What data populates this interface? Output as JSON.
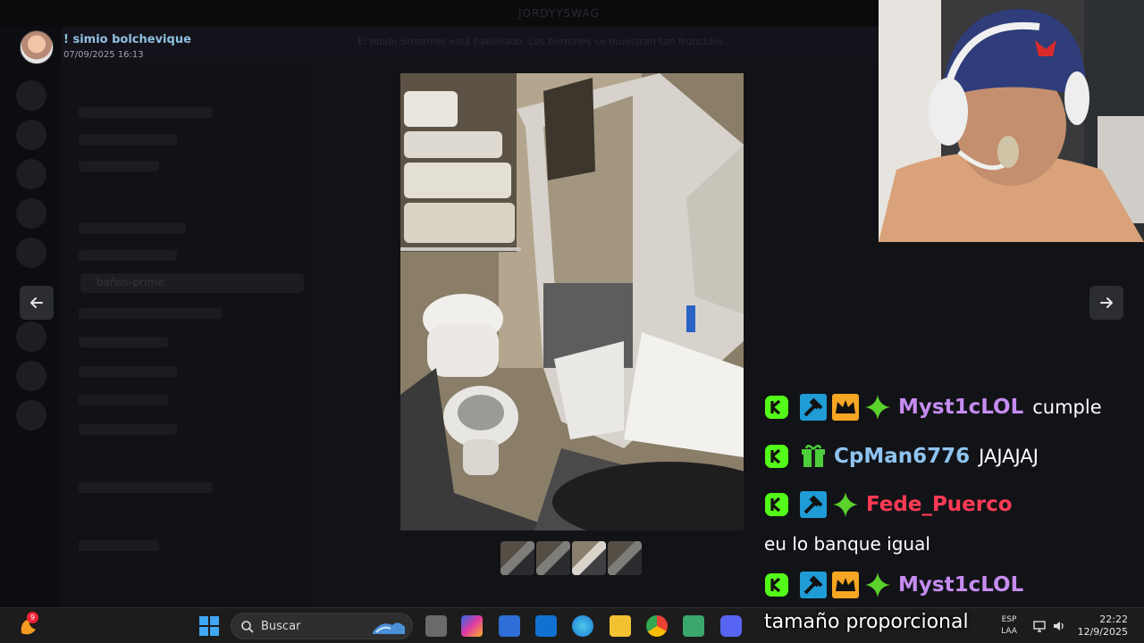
{
  "window": {
    "server_title": "JORDYY5WAG"
  },
  "background": {
    "banner_text": "El modo Streamer está habilitado. Los borrones se muestran tan fruncidos",
    "server_name": "JORDYY5WAG",
    "active_channel": "baños-prime",
    "chat_header": "baños-p"
  },
  "viewer": {
    "author": "! simio bolchevique",
    "date": "07/09/2025 16:13",
    "thumb_count": 4,
    "active_thumb": 3
  },
  "chat": [
    {
      "user": "Myst1cLOL",
      "user_color": "#c58cf0",
      "message": "cumple",
      "badges": [
        "kick",
        "moderator",
        "crown",
        "sparkle"
      ]
    },
    {
      "user": "CpMan6776",
      "user_color": "#8ec4f0",
      "message": "JAJAJAJ",
      "badges": [
        "kick",
        "gift"
      ]
    },
    {
      "user": "Fede_Puerco",
      "user_color": "#ff3a55",
      "message": "eu lo banque igual",
      "badges": [
        "kick",
        "moderator",
        "sparkle"
      ]
    },
    {
      "user": "Myst1cLOL",
      "user_color": "#c58cf0",
      "message": "",
      "badges": [
        "kick",
        "moderator",
        "crown",
        "sparkle"
      ]
    }
  ],
  "overlay_text": "tamaño proporcional",
  "taskbar": {
    "widget_badge": "9",
    "search_label": "Buscar",
    "lang_line1": "ESP",
    "lang_line2": "LAA",
    "time": "22:22",
    "date": "12/9/2025"
  },
  "colors": {
    "kick_green": "#53fc18",
    "moderator_blue": "#1f9bd6",
    "crown_gold": "#f5a623",
    "sparkle_green": "#5bd12c",
    "gift_green": "#4ccf3a"
  }
}
